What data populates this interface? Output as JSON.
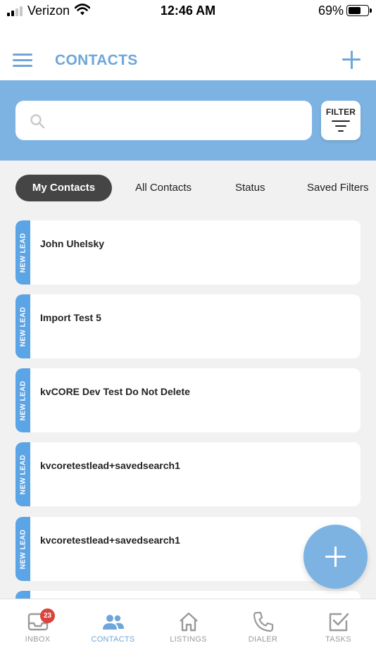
{
  "status_bar": {
    "carrier": "Verizon",
    "time": "12:46 AM",
    "battery": "69%",
    "battery_level": 0.69
  },
  "header": {
    "title": "CONTACTS"
  },
  "search": {
    "placeholder": "",
    "value": ""
  },
  "filter": {
    "label": "FILTER"
  },
  "tabs": [
    {
      "label": "My Contacts",
      "active": true
    },
    {
      "label": "All Contacts",
      "active": false
    },
    {
      "label": "Status",
      "active": false
    },
    {
      "label": "Saved Filters",
      "active": false
    }
  ],
  "contacts": [
    {
      "name": "John Uhelsky",
      "status": "NEW LEAD"
    },
    {
      "name": "Import Test 5",
      "status": "NEW LEAD"
    },
    {
      "name": "kvCORE Dev Test Do Not Delete",
      "status": "NEW LEAD"
    },
    {
      "name": "kvcoretestlead+savedsearch1",
      "status": "NEW LEAD"
    },
    {
      "name": "kvcoretestlead+savedsearch1",
      "status": "NEW LEAD"
    }
  ],
  "nav": [
    {
      "label": "INBOX",
      "icon": "inbox-icon",
      "badge": "23"
    },
    {
      "label": "CONTACTS",
      "icon": "contacts-icon",
      "active": true
    },
    {
      "label": "LISTINGS",
      "icon": "home-icon"
    },
    {
      "label": "DIALER",
      "icon": "phone-icon"
    },
    {
      "label": "TASKS",
      "icon": "tasks-icon"
    }
  ],
  "colors": {
    "accent": "#7db3e2",
    "title": "#6ea6d9",
    "lead_strip": "#5ba4e6",
    "active_tab": "#454545",
    "badge": "#d9443c"
  }
}
